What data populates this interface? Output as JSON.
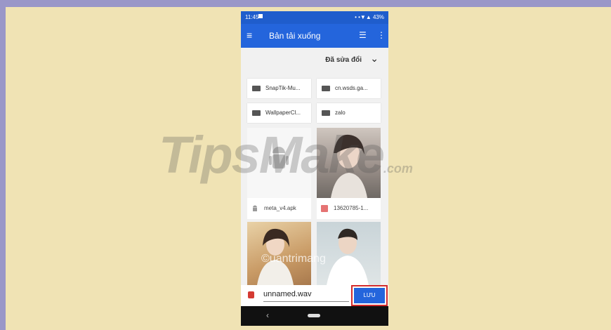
{
  "status_bar": {
    "time": "11:45",
    "indicators": "• •▼▲ 43%"
  },
  "app_bar": {
    "menu_icon": "≡",
    "title": "Bản tải xuống",
    "list_icon": "☰",
    "more_icon": "⋮"
  },
  "sort": {
    "label": "Đã sửa đổi",
    "chevron": "⌄"
  },
  "folders": [
    "SnapTik-Mu...",
    "cn.wsds.ga...",
    "WallpaperCl...",
    "zalo"
  ],
  "files": [
    {
      "name": "meta_v4.apk",
      "type": "apk"
    },
    {
      "name": "13620785-1...",
      "type": "image"
    }
  ],
  "save_bar": {
    "filename": "unnamed.wav",
    "button": "LƯU"
  },
  "nav": {
    "back": "‹"
  },
  "watermark": {
    "brand": "TipsMake",
    "suffix": ".com",
    "secondary": "©uantrimang"
  },
  "colors": {
    "primary": "#2465dc",
    "highlight": "#d32b2b",
    "background": "#f0e3b4",
    "frame": "#9a97c8"
  }
}
